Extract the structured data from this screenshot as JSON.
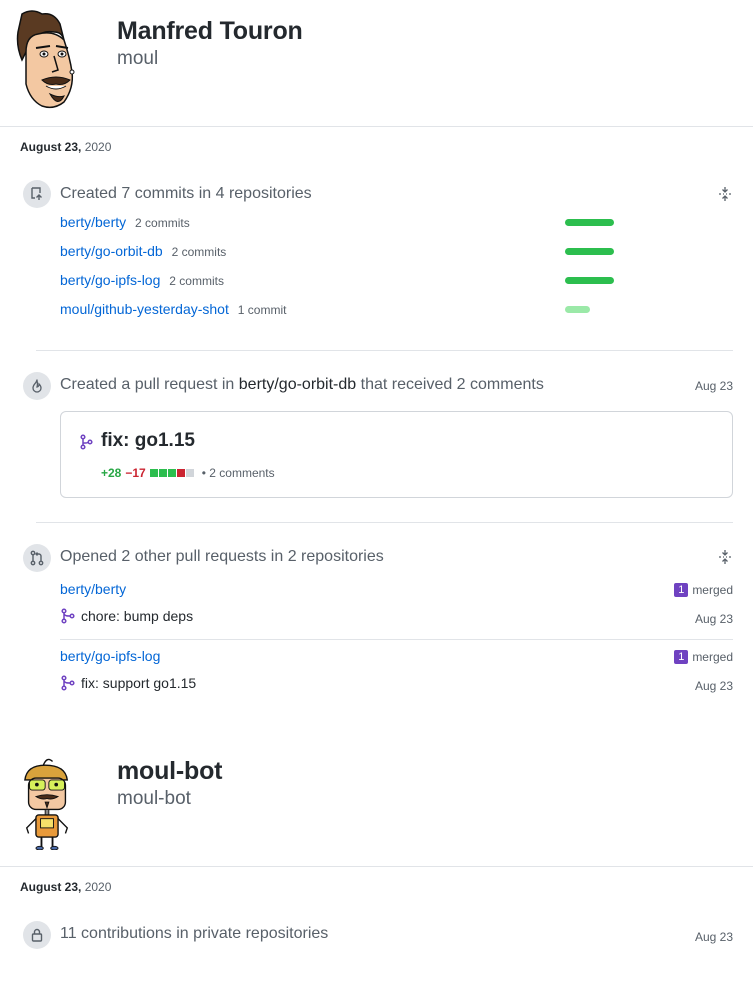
{
  "profiles": [
    {
      "name": "Manfred Touron",
      "login": "moul",
      "activity": {
        "date_day": "August 23,",
        "date_year": "2020",
        "commits_event": {
          "title": "Created 7 commits in 4 repositories",
          "repos": [
            {
              "name": "berty/berty",
              "count": "2 commits",
              "fill": 1.0
            },
            {
              "name": "berty/go-orbit-db",
              "count": "2 commits",
              "fill": 1.0
            },
            {
              "name": "berty/go-ipfs-log",
              "count": "2 commits",
              "fill": 1.0
            },
            {
              "name": "moul/github-yesterday-shot",
              "count": "1 commit",
              "fill": 0.5
            }
          ]
        },
        "pr_event": {
          "title_prefix": "Created a pull request in",
          "repo": "berty/go-orbit-db",
          "title_suffix": "that received 2 comments",
          "date": "Aug 23",
          "pr_title": "fix: go1.15",
          "additions": "+28",
          "deletions": "−17",
          "bullet": "•",
          "comments": "2 comments"
        },
        "other_prs_event": {
          "title": "Opened 2 other pull requests in 2 repositories",
          "items": [
            {
              "repo": "berty/berty",
              "badge": "1",
              "status": "merged",
              "pr_title": "chore: bump deps",
              "date": "Aug 23"
            },
            {
              "repo": "berty/go-ipfs-log",
              "badge": "1",
              "status": "merged",
              "pr_title": "fix: support go1.15",
              "date": "Aug 23"
            }
          ]
        }
      }
    },
    {
      "name": "moul-bot",
      "login": "moul-bot",
      "activity": {
        "date_day": "August 23,",
        "date_year": "2020",
        "private_event": {
          "title": "11 contributions in private repositories",
          "date": "Aug 23"
        }
      }
    }
  ],
  "colors": {
    "link": "#0366d6",
    "commit_bar": "#2cbe4e",
    "commit_bar_light": "#9be9a8",
    "merged_badge": "#6f42c1",
    "additions": "#28a745",
    "deletions": "#cb2431"
  },
  "icons": {
    "push": "repo-push-icon",
    "pr": "git-pull-request-icon",
    "flame": "flame-icon",
    "lock": "lock-icon",
    "collapse": "fold-icon"
  }
}
